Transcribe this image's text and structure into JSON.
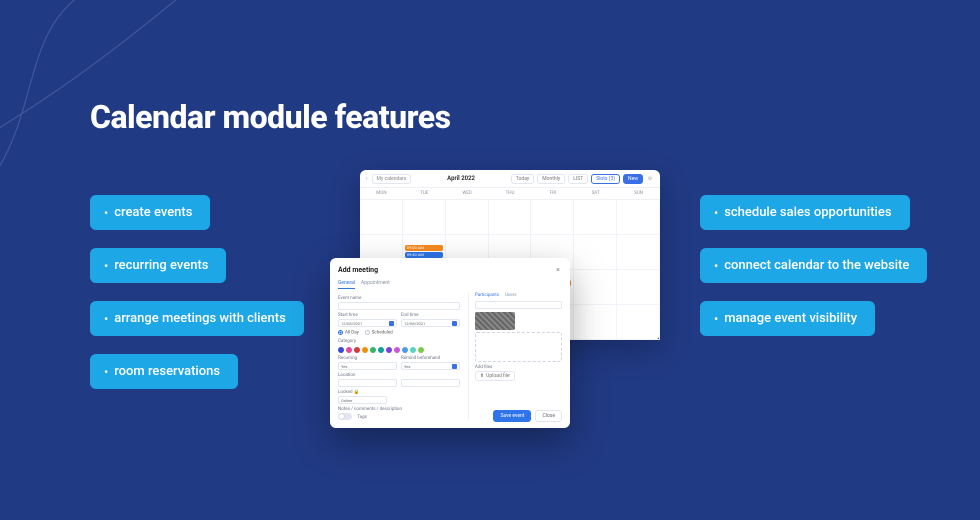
{
  "title": "Calendar module features",
  "features_left": [
    "create events",
    "recurring events",
    "arrange meetings with clients",
    "room reservations"
  ],
  "features_right": [
    "schedule sales opportunities",
    "connect calendar to the website",
    "manage event visibility"
  ],
  "calendar": {
    "nav_label": "My calendars",
    "month_title": "April 2022",
    "views": {
      "today": "Today",
      "monthly": "Monthly",
      "list": "LIST",
      "slots": "Slots (3)",
      "new": "New"
    },
    "days": [
      "MON",
      "TUE",
      "WED",
      "THU",
      "FRI",
      "SAT",
      "SUN"
    ],
    "events": {
      "e1": "09:00 AM",
      "e2": "09:40 AM",
      "e3": "09:00 AM"
    }
  },
  "modal": {
    "title": "Add meeting",
    "tabs": {
      "general": "General",
      "appointment": "Appointment"
    },
    "labels": {
      "eventname": "Event name",
      "starttime": "Start time",
      "endtime": "End time",
      "allday": "All Day",
      "scheduled": "Scheduled",
      "category": "Category",
      "recurring": "Recurring",
      "remind": "Remind beforehand",
      "yes": "Yes",
      "location": "Location",
      "locked": "Locked",
      "online": "Online",
      "notes": "Notes / comments / description",
      "tags": "Tags",
      "participants": "Participants",
      "users": "Users",
      "addfiles": "Add files",
      "upload": "Upload file"
    },
    "date": "12/08/2021",
    "buttons": {
      "save": "Save event",
      "close": "Close"
    },
    "palette": [
      "#374bd8",
      "#e14a9b",
      "#d43a3a",
      "#e8920b",
      "#36b36b",
      "#139e9e",
      "#7a41d6",
      "#c957d7",
      "#4a9be8",
      "#5bd1c0",
      "#7ec94a"
    ]
  }
}
